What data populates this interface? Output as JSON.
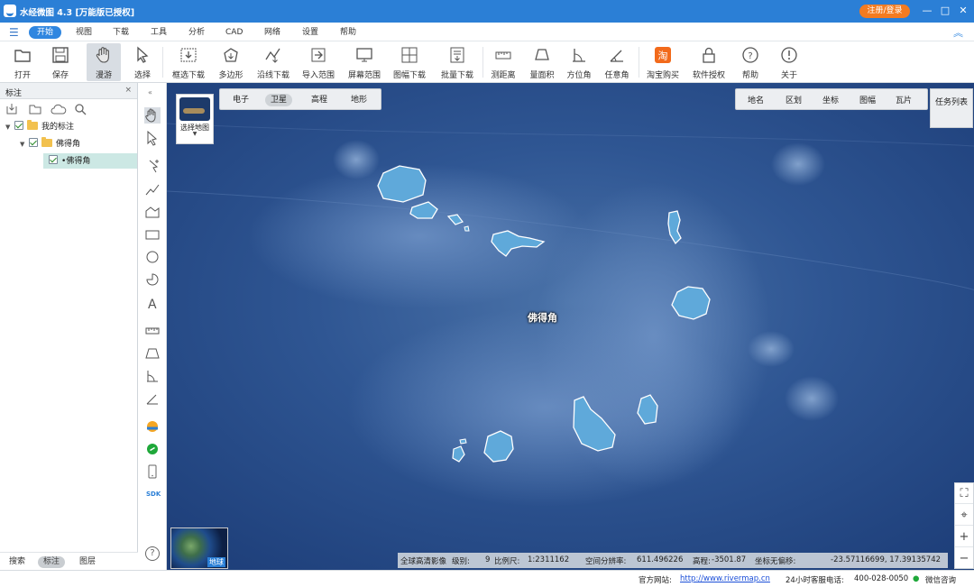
{
  "titlebar": {
    "title": "水经微图 4.3 [万能版已授权]",
    "login": "注册/登录",
    "min": "—",
    "max": "□",
    "close": "✕"
  },
  "menu": {
    "items": [
      "开始",
      "视图",
      "下载",
      "工具",
      "分析",
      "CAD",
      "网络",
      "设置",
      "帮助"
    ]
  },
  "toolbar": {
    "open": "打开",
    "save": "保存",
    "roam": "漫游",
    "select": "选择",
    "box_download": "框选下载",
    "polygon": "多边形",
    "line_download": "沿线下载",
    "import_range": "导入范围",
    "screen_range": "屏幕范围",
    "sheet_download": "图幅下载",
    "batch_download": "批量下载",
    "measure_distance": "测距离",
    "measure_area": "量面积",
    "azimuth": "方位角",
    "any_angle": "任意角",
    "taobao": "淘宝购买",
    "license": "软件授权",
    "help": "帮助",
    "about": "关于"
  },
  "leftpanel": {
    "title": "标注",
    "close": "×",
    "root": "我的标注",
    "folder": "佛得角",
    "item": "佛得角",
    "tabs": {
      "search": "搜索",
      "annotation": "标注",
      "layers": "图层"
    }
  },
  "sidebar": {
    "sdk": "SDK",
    "help": "?"
  },
  "map": {
    "map_types": [
      "电子",
      "卫星",
      "高程",
      "地形"
    ],
    "selected_type": "卫星",
    "select_map_label": "选择地图",
    "layers": [
      "地名",
      "区划",
      "坐标",
      "图幅",
      "瓦片"
    ],
    "task_list": "任务列表",
    "place_label": "佛得角",
    "globe_label": "地球"
  },
  "mapstatus": {
    "source": "全球高清影像",
    "level_label": "级别:",
    "level": "9",
    "scale_label": "比例尺:",
    "scale": "1:2311162",
    "resolution_label": "空间分辨率:",
    "resolution": "611.496226",
    "elevation_label": "高程:",
    "elevation": "-3501.87",
    "coord_label": "坐标无偏移:",
    "coords": "-23.57116699, 17.39135742"
  },
  "statusbar": {
    "website_label": "官方网站:",
    "website": "http://www.rivermap.cn",
    "phone_label": "24小时客服电话:",
    "phone": "400-028-0050",
    "wechat": "微信咨询"
  },
  "colors": {
    "accent": "#2b7fd6",
    "ocean": "#2d4f8a",
    "island": "#5aa3d6"
  }
}
